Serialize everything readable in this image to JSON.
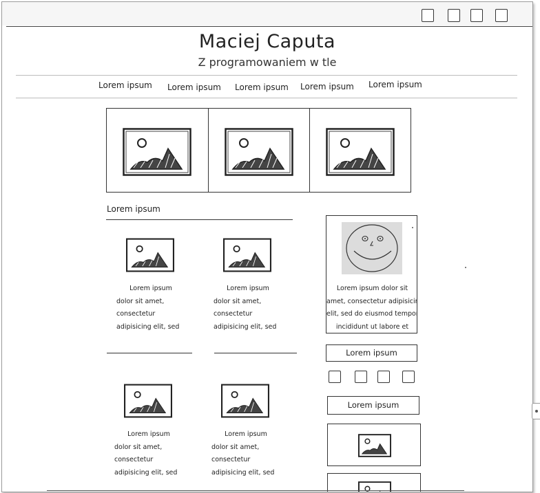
{
  "header": {
    "title": "Maciej Caputa",
    "subtitle": "Z programowaniem w tle"
  },
  "toolbar": {
    "icons": [
      "square-icon",
      "square-icon",
      "square-icon",
      "square-icon"
    ]
  },
  "nav": {
    "items": [
      "Lorem ipsum",
      "Lorem ipsum",
      "Lorem ipsum",
      "Lorem ipsum",
      "Lorem ipsum"
    ]
  },
  "slider": {
    "slides": [
      "image-placeholder",
      "image-placeholder",
      "image-placeholder"
    ]
  },
  "section": {
    "title": "Lorem ipsum"
  },
  "cards": [
    {
      "line1": "Lorem ipsum",
      "rest": "dolor sit amet, consectetur adipisicing elit, sed do eiusmod tempor"
    },
    {
      "line1": "Lorem ipsum",
      "rest": "dolor sit amet, consectetur adipisicing elit, sed do eiusmod tempor"
    },
    {
      "line1": "Lorem ipsum",
      "rest": "dolor sit amet, consectetur adipisicing elit, sed do eiusmod tempor"
    },
    {
      "line1": "Lorem ipsum",
      "rest": "dolor sit amet, consectetur adipisicing elit, sed do eiusmod tempor"
    }
  ],
  "profile": {
    "lines": [
      "Lorem ipsum dolor sit",
      "amet, consectetur adipisicing",
      "elit, sed do eiusmod tempor",
      "incididunt ut labore et"
    ]
  },
  "sidebar": {
    "button1": "Lorem ipsum",
    "button2": "Lorem ipsum",
    "social_icons": [
      "square-icon",
      "square-icon",
      "square-icon",
      "square-icon"
    ]
  }
}
